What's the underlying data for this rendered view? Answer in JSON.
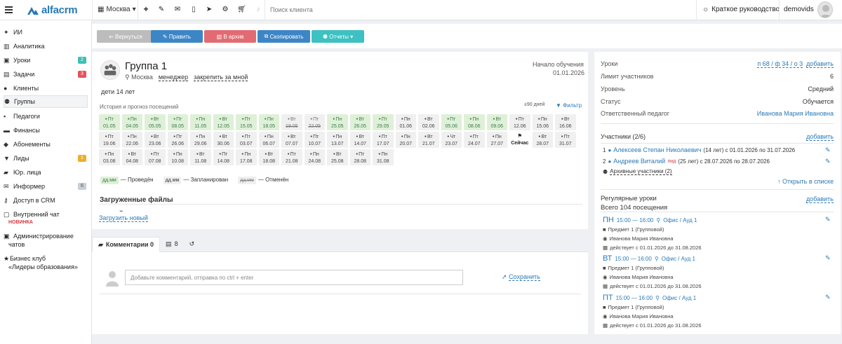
{
  "topbar": {
    "logo_text": "alfacrm",
    "city": "Москва",
    "search_placeholder": "Поиск клиента",
    "guide": "Краткое руководство",
    "username": "demovids"
  },
  "sidebar": {
    "items": [
      {
        "label": "ИИ",
        "icon": "sparkle-icon"
      },
      {
        "label": "Аналитика",
        "icon": "chart-icon"
      },
      {
        "label": "Уроки",
        "icon": "calendar-icon",
        "badge": "2",
        "badge_color": "#3fbfb6"
      },
      {
        "label": "Задачи",
        "icon": "tasks-icon",
        "badge": "3",
        "badge_color": "#e5535b"
      },
      {
        "label": "Клиенты",
        "icon": "user-icon"
      },
      {
        "label": "Группы",
        "icon": "users-icon"
      },
      {
        "label": "Педагоги",
        "icon": "teacher-icon"
      },
      {
        "label": "Финансы",
        "icon": "money-icon"
      },
      {
        "label": "Абонементы",
        "icon": "ticket-icon"
      },
      {
        "label": "Лиды",
        "icon": "funnel-icon",
        "badge": "1",
        "badge_color": "#f0ad2c"
      },
      {
        "label": "Юр. лица",
        "icon": "briefcase-icon"
      },
      {
        "label": "Информер",
        "icon": "envelope-icon",
        "badge": "6",
        "badge_color": "#c7d0d6"
      },
      {
        "label": "Доступ в CRM",
        "icon": "key-icon"
      }
    ],
    "chat_label": "Внутренний чат",
    "chat_new": "НОВИНКА",
    "admin_line1": "Администрирование",
    "admin_line2": "чатов",
    "club_line1": "Бизнес клуб",
    "club_line2": "«Лидеры образования»"
  },
  "actions": {
    "back": "Вернуться",
    "edit": "Править",
    "archive": "В архив",
    "copy": "Скопировать",
    "reports": "Отчеты"
  },
  "group": {
    "title": "Группа 1",
    "city": "Москва",
    "manager": "менеджер",
    "assign": "закрепить за мной",
    "start_label": "Начало обучения",
    "start_date": "01.01.2026",
    "age": "дети 14 лет",
    "history_label": "История и прогноз посещений",
    "days": "±90 дней",
    "filter": "Фильтр"
  },
  "lessons": [
    {
      "wd": "Пт",
      "d": "01.05",
      "s": "done"
    },
    {
      "wd": "Пн",
      "d": "04.05",
      "s": "done"
    },
    {
      "wd": "Вт",
      "d": "05.05",
      "s": "done"
    },
    {
      "wd": "Пт",
      "d": "08.05",
      "s": "done"
    },
    {
      "wd": "Пн",
      "d": "11.05",
      "s": "done"
    },
    {
      "wd": "Вт",
      "d": "12.05",
      "s": "done"
    },
    {
      "wd": "Пт",
      "d": "15.05",
      "s": "done"
    },
    {
      "wd": "Пн",
      "d": "18.05",
      "s": "done"
    },
    {
      "wd": "Вт",
      "d": "19.05",
      "s": "canc"
    },
    {
      "wd": "Пт",
      "d": "22.05",
      "s": "canc"
    },
    {
      "wd": "Пн",
      "d": "25.05",
      "s": "done"
    },
    {
      "wd": "Вт",
      "d": "26.05",
      "s": "done"
    },
    {
      "wd": "Пт",
      "d": "29.05",
      "s": "done"
    },
    {
      "wd": "Пн",
      "d": "01.06",
      "s": "plan"
    },
    {
      "wd": "Вт",
      "d": "02.06",
      "s": "plan"
    },
    {
      "wd": "Пт",
      "d": "05.06",
      "s": "done"
    },
    {
      "wd": "Пн",
      "d": "08.06",
      "s": "done"
    },
    {
      "wd": "Вт",
      "d": "09.06",
      "s": "done"
    },
    {
      "wd": "Пт",
      "d": "12.06",
      "s": "plan"
    },
    {
      "wd": "Пн",
      "d": "15.06",
      "s": "plan"
    },
    {
      "wd": "Вт",
      "d": "16.06",
      "s": "plan"
    },
    {
      "wd": "Пт",
      "d": "19.06",
      "s": "plan"
    },
    {
      "wd": "Пн",
      "d": "22.06",
      "s": "plan"
    },
    {
      "wd": "Вт",
      "d": "23.06",
      "s": "plan"
    },
    {
      "wd": "Пт",
      "d": "26.06",
      "s": "plan"
    },
    {
      "wd": "Пн",
      "d": "29.06",
      "s": "plan"
    },
    {
      "wd": "Вт",
      "d": "30.06",
      "s": "plan"
    },
    {
      "wd": "Пт",
      "d": "03.07",
      "s": "plan"
    },
    {
      "wd": "Пн",
      "d": "06.07",
      "s": "plan"
    },
    {
      "wd": "Вт",
      "d": "07.07",
      "s": "plan"
    },
    {
      "wd": "Пт",
      "d": "10.07",
      "s": "plan"
    },
    {
      "wd": "Пн",
      "d": "13.07",
      "s": "plan"
    },
    {
      "wd": "Вт",
      "d": "14.07",
      "s": "plan"
    },
    {
      "wd": "Пт",
      "d": "17.07",
      "s": "plan"
    },
    {
      "wd": "Пн",
      "d": "20.07",
      "s": "plan"
    },
    {
      "wd": "Вт",
      "d": "21.07",
      "s": "plan"
    },
    {
      "wd": "Чт",
      "d": "23.07",
      "s": "plan"
    },
    {
      "wd": "Пт",
      "d": "24.07",
      "s": "plan"
    },
    {
      "wd": "Пн",
      "d": "27.07",
      "s": "plan"
    },
    {
      "wd": "⚑",
      "d": "Сейчас",
      "s": "today"
    },
    {
      "wd": "Вт",
      "d": "28.07",
      "s": "plan"
    },
    {
      "wd": "Пт",
      "d": "31.07",
      "s": "plan"
    },
    {
      "wd": "Пн",
      "d": "03.08",
      "s": "plan"
    },
    {
      "wd": "Вт",
      "d": "04.08",
      "s": "plan"
    },
    {
      "wd": "Пт",
      "d": "07.08",
      "s": "plan"
    },
    {
      "wd": "Пн",
      "d": "10.08",
      "s": "plan"
    },
    {
      "wd": "Вт",
      "d": "11.08",
      "s": "plan"
    },
    {
      "wd": "Пт",
      "d": "14.08",
      "s": "plan"
    },
    {
      "wd": "Пн",
      "d": "17.08",
      "s": "plan"
    },
    {
      "wd": "Вт",
      "d": "18.08",
      "s": "plan"
    },
    {
      "wd": "Пт",
      "d": "21.08",
      "s": "plan"
    },
    {
      "wd": "Пн",
      "d": "24.08",
      "s": "plan"
    },
    {
      "wd": "Вт",
      "d": "25.08",
      "s": "plan"
    },
    {
      "wd": "Пт",
      "d": "28.08",
      "s": "plan"
    },
    {
      "wd": "Пн",
      "d": "31.08",
      "s": "plan"
    }
  ],
  "legend": {
    "swatch": "дд.мм",
    "done": "— Проведён",
    "plan": "— Запланирован",
    "canc": "— Отменён"
  },
  "files": {
    "title": "Загруженные файлы",
    "upload": "Загрузить новый"
  },
  "comments": {
    "tab_comments": "Комментарии 0",
    "tab_count": "8",
    "placeholder": "Добавьте комментарий, отправка по ctrl + enter",
    "save": "Сохранить"
  },
  "info": {
    "lessons_label": "Уроки",
    "lessons_value": "п 68 / ф 34 / о 3",
    "lessons_add": "добавить",
    "limit_label": "Лимит участников",
    "limit_value": "6",
    "level_label": "Уровень",
    "level_value": "Средний",
    "status_label": "Статус",
    "status_value": "Обучается",
    "teacher_label": "Ответственный педагог",
    "teacher_value": "Иванова Мария Ивановна"
  },
  "participants": {
    "title": "Участники (2/6)",
    "add": "добавить",
    "list": [
      {
        "num": "1",
        "name": "Алексеев Степан Николаевич",
        "lid": "",
        "info": "(14 лет) с 01.01.2026 по 31.07.2026"
      },
      {
        "num": "2",
        "name": "Андреев Виталий",
        "lid": "лид",
        "info": "(25 лет) с 28.07.2026 по 28.07.2026"
      }
    ],
    "archive": "Архивные участники (2)",
    "open_list": "Открыть в списке"
  },
  "regular": {
    "title": "Регулярные уроки",
    "total": "Всего 104 посещения",
    "add": "добавить",
    "items": [
      {
        "day": "ПН",
        "time": "15:00 — 16:00",
        "place": "Офис / Ауд 1",
        "subject": "Предмет 1 (Групповой)",
        "teacher": "Иванова Мария Ивановна",
        "period": "действует с 01.01.2026 до 31.08.2026"
      },
      {
        "day": "ВТ",
        "time": "15:00 — 16:00",
        "place": "Офис / Ауд 1",
        "subject": "Предмет 1 (Групповой)",
        "teacher": "Иванова Мария Ивановна",
        "period": "действует с 01.01.2026 до 31.08.2026"
      },
      {
        "day": "ПТ",
        "time": "15:00 — 16:00",
        "place": "Офис / Ауд 1",
        "subject": "Предмет 1 (Групповой)",
        "teacher": "Иванова Мария Ивановна",
        "period": "действует с 01.01.2026 до 31.08.2026"
      }
    ]
  }
}
